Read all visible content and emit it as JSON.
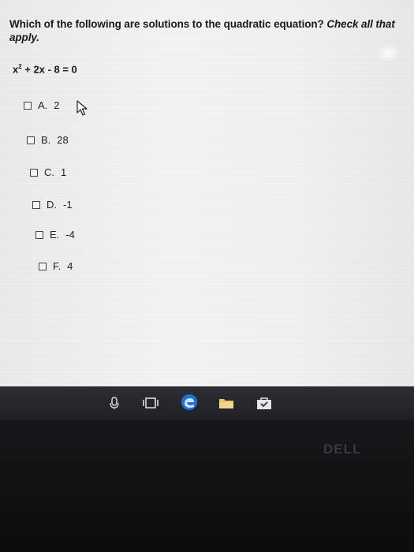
{
  "question": {
    "text": "Which of the following are solutions to the quadratic equation?",
    "instruction": "Check all that apply."
  },
  "equation": {
    "lhs_base": "x",
    "exponent": "2",
    "rest": " + 2x - 8 = 0"
  },
  "options": [
    {
      "letter": "A.",
      "value": "2"
    },
    {
      "letter": "B.",
      "value": "28"
    },
    {
      "letter": "C.",
      "value": "1"
    },
    {
      "letter": "D.",
      "value": "-1"
    },
    {
      "letter": "E.",
      "value": "-4"
    },
    {
      "letter": "F.",
      "value": "4"
    }
  ],
  "taskbar": {
    "icons": [
      "task-view-icon",
      "edge-browser-icon",
      "file-explorer-icon",
      "store-icon"
    ]
  },
  "bezel": {
    "logo": "DELL"
  },
  "colors": {
    "screen_bg": "#f2f2f2",
    "text": "#1a1a1a",
    "taskbar": "#2b2e33",
    "edge_blue": "#1f72d6"
  }
}
